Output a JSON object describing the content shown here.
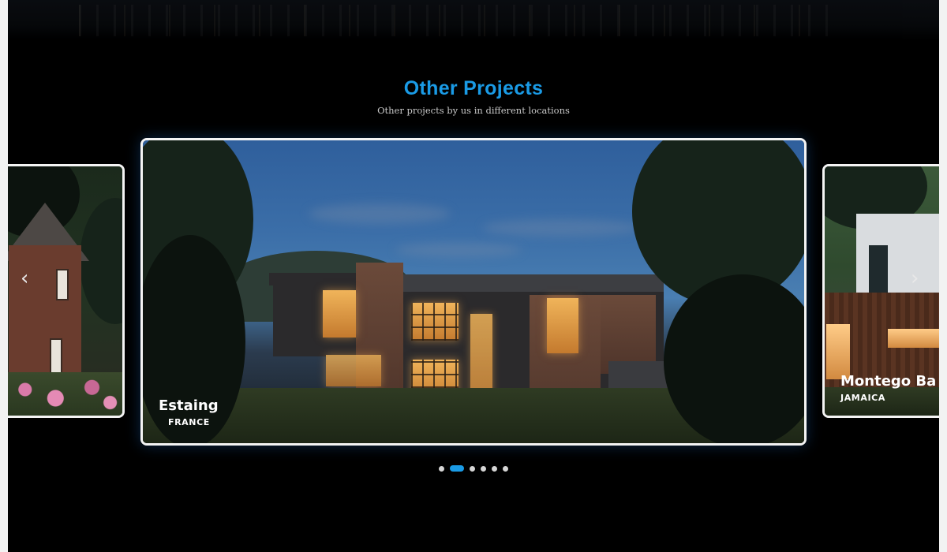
{
  "section": {
    "title": "Other Projects",
    "subtitle": "Other projects by us in different locations"
  },
  "carousel": {
    "prev_icon": "chevron-left-icon",
    "next_icon": "chevron-right-icon",
    "prev_glyph": "‹",
    "next_glyph": "›",
    "slides": [
      {
        "name": "",
        "country": ""
      },
      {
        "name": "Estaing",
        "country": "FRANCE"
      },
      {
        "name": "Montego Ba",
        "country": "JAMAICA"
      }
    ],
    "dots": {
      "count": 6,
      "active_index": 1
    }
  },
  "colors": {
    "accent": "#1a9be6",
    "background": "#000000"
  }
}
